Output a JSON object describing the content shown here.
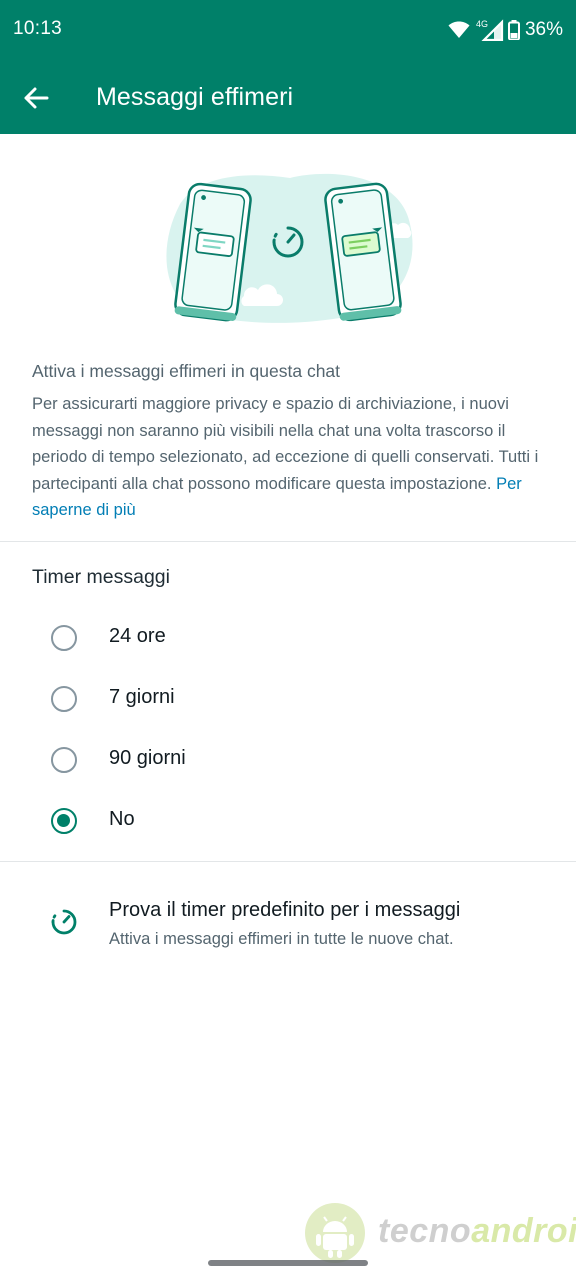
{
  "status_bar": {
    "time": "10:13",
    "network_type": "4G",
    "battery": "36%",
    "icons": [
      "wifi-icon",
      "signal-icon",
      "battery-icon"
    ]
  },
  "app_bar": {
    "title": "Messaggi effimeri",
    "back_icon": "arrow-back-icon"
  },
  "intro": {
    "title": "Attiva i messaggi effimeri in questa chat",
    "body": "Per assicurarti maggiore privacy e spazio di archiviazione, i nuovi messaggi non saranno più visibili nella chat una volta trascorso il periodo di tempo selezionato, ad eccezione di quelli conservati. Tutti i partecipanti alla chat possono modificare questa impostazione. ",
    "link": "Per saperne di più"
  },
  "timer": {
    "title": "Timer messaggi",
    "options": [
      {
        "label": "24 ore",
        "selected": false
      },
      {
        "label": "7 giorni",
        "selected": false
      },
      {
        "label": "90 giorni",
        "selected": false
      },
      {
        "label": "No",
        "selected": true
      }
    ]
  },
  "default_timer": {
    "title": "Prova il timer predefinito per i messaggi",
    "subtitle": "Attiva i messaggi effimeri in tutte le nuove chat.",
    "icon": "timer-icon"
  },
  "watermark": {
    "text_a": "tecno",
    "text_b": "android"
  },
  "colors": {
    "primary": "#008069",
    "link": "#027eb5",
    "secondary_text": "#54656f",
    "radio_off": "#8696a0"
  }
}
